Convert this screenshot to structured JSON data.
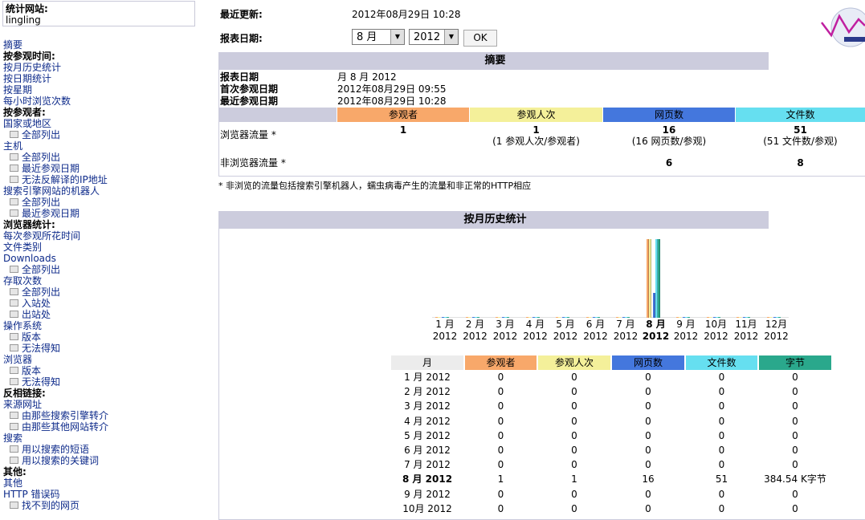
{
  "site": {
    "label": "统计网站:",
    "name": "lingling"
  },
  "menu": [
    {
      "t": "link",
      "label": "摘要"
    },
    {
      "t": "head",
      "label": "按参观时间:"
    },
    {
      "t": "link",
      "label": "按月历史统计"
    },
    {
      "t": "link",
      "label": "按日期统计"
    },
    {
      "t": "link",
      "label": "按星期"
    },
    {
      "t": "link",
      "label": "每小时浏览次数"
    },
    {
      "t": "head",
      "label": "按参观者:"
    },
    {
      "t": "link",
      "label": "国家或地区"
    },
    {
      "t": "sub",
      "label": "全部列出"
    },
    {
      "t": "link",
      "label": "主机"
    },
    {
      "t": "sub",
      "label": "全部列出"
    },
    {
      "t": "sub",
      "label": "最近参观日期"
    },
    {
      "t": "sub",
      "label": "无法反解译的IP地址"
    },
    {
      "t": "link",
      "label": "搜索引擎网站的机器人"
    },
    {
      "t": "sub",
      "label": "全部列出"
    },
    {
      "t": "sub",
      "label": "最近参观日期"
    },
    {
      "t": "head",
      "label": "浏览器统计:"
    },
    {
      "t": "link",
      "label": "每次参观所花时间"
    },
    {
      "t": "link",
      "label": "文件类别"
    },
    {
      "t": "link",
      "label": "Downloads"
    },
    {
      "t": "sub",
      "label": "全部列出"
    },
    {
      "t": "link",
      "label": "存取次数"
    },
    {
      "t": "sub",
      "label": "全部列出"
    },
    {
      "t": "sub",
      "label": "入站处"
    },
    {
      "t": "sub",
      "label": "出站处"
    },
    {
      "t": "link",
      "label": "操作系统"
    },
    {
      "t": "sub",
      "label": "版本"
    },
    {
      "t": "sub",
      "label": "无法得知"
    },
    {
      "t": "link",
      "label": "浏览器"
    },
    {
      "t": "sub",
      "label": "版本"
    },
    {
      "t": "sub",
      "label": "无法得知"
    },
    {
      "t": "head",
      "label": "反相链接:"
    },
    {
      "t": "link",
      "label": "来源网址"
    },
    {
      "t": "sub",
      "label": "由那些搜索引擎转介"
    },
    {
      "t": "sub",
      "label": "由那些其他网站转介"
    },
    {
      "t": "link",
      "label": "搜索"
    },
    {
      "t": "sub",
      "label": "用以搜索的短语"
    },
    {
      "t": "sub",
      "label": "用以搜索的关键词"
    },
    {
      "t": "head",
      "label": "其他:"
    },
    {
      "t": "link",
      "label": "其他"
    },
    {
      "t": "link",
      "label": "HTTP 错误码"
    },
    {
      "t": "sub",
      "label": "找不到的网页"
    }
  ],
  "header": {
    "last_update_label": "最近更新:",
    "last_update_value": "2012年08月29日 10:28",
    "report_date_label": "报表日期:",
    "month_select": "8 月",
    "year_select": "2012",
    "ok_label": "OK"
  },
  "summary": {
    "title": "摘要",
    "rows": [
      {
        "k": "报表日期",
        "v": "月 8 月 2012"
      },
      {
        "k": "首次参观日期",
        "v": "2012年08月29日 09:55"
      },
      {
        "k": "最近参观日期",
        "v": "2012年08月29日 10:28"
      }
    ],
    "columns": [
      "参观者",
      "参观人次",
      "网页数",
      "文件数"
    ],
    "viewed_label": "浏览器流量 *",
    "viewed": {
      "visitors": "1",
      "visits": "1",
      "visits_sub": "(1 参观人次/参观者)",
      "pages": "16",
      "pages_sub": "(16 网页数/参观)",
      "hits": "51",
      "hits_sub": "(51 文件数/参观)"
    },
    "not_viewed_label": "非浏览器流量 *",
    "not_viewed": {
      "pages": "6",
      "hits": "8"
    },
    "note": "* 非浏览的流量包括搜索引擎机器人，蠕虫病毒产生的流量和非正常的HTTP相应"
  },
  "history": {
    "title": "按月历史统计",
    "columns": [
      "月",
      "参观者",
      "参观人次",
      "网页数",
      "文件数",
      "字节"
    ],
    "rows": [
      {
        "m": "1 月 2012",
        "v": "0",
        "s": "0",
        "p": "0",
        "h": "0",
        "b": "0"
      },
      {
        "m": "2 月 2012",
        "v": "0",
        "s": "0",
        "p": "0",
        "h": "0",
        "b": "0"
      },
      {
        "m": "3 月 2012",
        "v": "0",
        "s": "0",
        "p": "0",
        "h": "0",
        "b": "0"
      },
      {
        "m": "4 月 2012",
        "v": "0",
        "s": "0",
        "p": "0",
        "h": "0",
        "b": "0"
      },
      {
        "m": "5 月 2012",
        "v": "0",
        "s": "0",
        "p": "0",
        "h": "0",
        "b": "0"
      },
      {
        "m": "6 月 2012",
        "v": "0",
        "s": "0",
        "p": "0",
        "h": "0",
        "b": "0"
      },
      {
        "m": "7 月 2012",
        "v": "0",
        "s": "0",
        "p": "0",
        "h": "0",
        "b": "0"
      },
      {
        "m": "8 月 2012",
        "v": "1",
        "s": "1",
        "p": "16",
        "h": "51",
        "b": "384.54 K字节",
        "cur": true
      },
      {
        "m": "9 月 2012",
        "v": "0",
        "s": "0",
        "p": "0",
        "h": "0",
        "b": "0"
      },
      {
        "m": "10月 2012",
        "v": "0",
        "s": "0",
        "p": "0",
        "h": "0",
        "b": "0"
      }
    ]
  },
  "chart_data": {
    "type": "bar",
    "categories": [
      "1 月",
      "2 月",
      "3 月",
      "4 月",
      "5 月",
      "6 月",
      "7 月",
      "8 月",
      "9 月",
      "10月",
      "11月",
      "12月"
    ],
    "year_labels": [
      "2012",
      "2012",
      "2012",
      "2012",
      "2012",
      "2012",
      "2012",
      "2012",
      "2012",
      "2012",
      "2012",
      "2012"
    ],
    "current_index": 7,
    "series": [
      {
        "name": "参观者",
        "color": "#f8a86a",
        "values": [
          0,
          0,
          0,
          0,
          0,
          0,
          0,
          1,
          0,
          0,
          0,
          0
        ]
      },
      {
        "name": "参观人次",
        "color": "#f4f09a",
        "values": [
          0,
          0,
          0,
          0,
          0,
          0,
          0,
          1,
          0,
          0,
          0,
          0
        ]
      },
      {
        "name": "网页数",
        "color": "#4477dd",
        "values": [
          0,
          0,
          0,
          0,
          0,
          0,
          0,
          16,
          0,
          0,
          0,
          0
        ]
      },
      {
        "name": "文件数",
        "color": "#66dff0",
        "values": [
          0,
          0,
          0,
          0,
          0,
          0,
          0,
          51,
          0,
          0,
          0,
          0
        ]
      },
      {
        "name": "字节",
        "color": "#2aa88c",
        "values": [
          0,
          0,
          0,
          0,
          0,
          0,
          0,
          384.54,
          0,
          0,
          0,
          0
        ]
      }
    ]
  }
}
